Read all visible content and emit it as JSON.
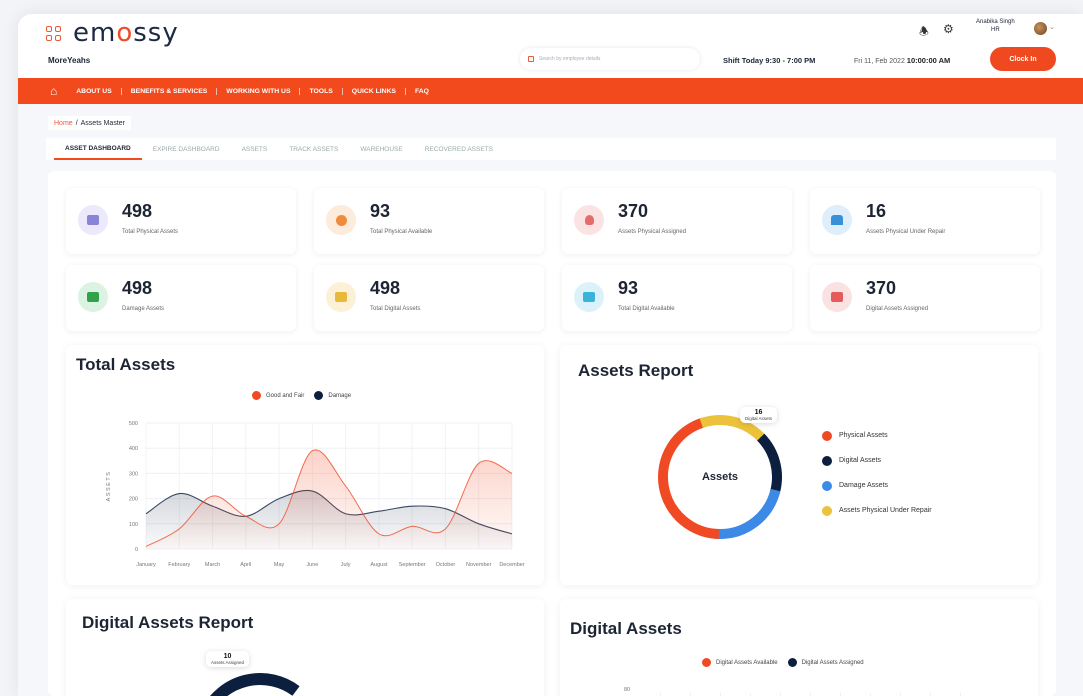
{
  "app": {
    "brand_a": "em",
    "brand_o": "o",
    "brand_b": "ssy",
    "company": "MoreYeahs"
  },
  "header": {
    "search_placeholder": "Search by employee details",
    "shift": "Shift Today 9:30 - 7:00 PM",
    "date_prefix": "Fri 11, Feb 2022",
    "time": "10:00:00 AM",
    "clock_in": "Clock In",
    "user_name": "Anabika Singh",
    "user_sub": "HR"
  },
  "nav": {
    "items": [
      "ABOUT US",
      "BENEFITS & SERVICES",
      "WORKING WITH US",
      "TOOLS",
      "QUICK LINKS",
      "FAQ"
    ]
  },
  "breadcrumb": {
    "home": "Home",
    "sep": "/",
    "current": "Assets Master"
  },
  "tabs": [
    "ASSET DASHBOARD",
    "EXPIRE DASHBOARD",
    "ASSETS",
    "TRACK ASSETS",
    "WAREHOUSE",
    "RECOVERED ASSETS"
  ],
  "cards": [
    {
      "value": "498",
      "label": "Total Physical Assets",
      "color": "#8a84d6",
      "bg": "#ebe9fb"
    },
    {
      "value": "93",
      "label": "Total Physical Available",
      "color": "#f08b3e",
      "bg": "#fdebdc"
    },
    {
      "value": "370",
      "label": "Assets Physical Assigned",
      "color": "#e86b6b",
      "bg": "#fbe3e3"
    },
    {
      "value": "16",
      "label": "Assets Physical Under Repair",
      "color": "#3a8fd9",
      "bg": "#dfeefb"
    },
    {
      "value": "498",
      "label": "Damage Assets",
      "color": "#2fa24a",
      "bg": "#dcf2e2"
    },
    {
      "value": "498",
      "label": "Total Digital Assets",
      "color": "#e9b93a",
      "bg": "#fcf1d6"
    },
    {
      "value": "93",
      "label": "Total Digital Available",
      "color": "#3ab2d9",
      "bg": "#dcf2fa"
    },
    {
      "value": "370",
      "label": "Digital Assets Assigned",
      "color": "#e55a5a",
      "bg": "#fbe2e2"
    }
  ],
  "total_assets": {
    "title": "Total Assets",
    "legend": [
      "Good and Fair",
      "Damage"
    ]
  },
  "assets_report": {
    "title": "Assets Report",
    "center": "Assets",
    "callout_value": "16",
    "callout_label": "Digital Assets",
    "legend": [
      "Physical Assets",
      "Digital Assets",
      "Damage Assets",
      "Assets Physical Under Repair"
    ],
    "colors": [
      "#f04a24",
      "#0d1f3f",
      "#3d8ae6",
      "#ecc13c"
    ]
  },
  "digital_report": {
    "title": "Digital Assets Report",
    "callout_value": "10",
    "callout_label": "Assets Assigned"
  },
  "digital_assets": {
    "title": "Digital Assets",
    "legend": [
      "Digital Assets Available",
      "Digital Assets Assigned"
    ],
    "first_tick": "80"
  },
  "chart_data": [
    {
      "type": "area",
      "title": "Total Assets",
      "ylabel": "ASSETS",
      "categories": [
        "January",
        "February",
        "March",
        "April",
        "May",
        "June",
        "July",
        "August",
        "September",
        "October",
        "November",
        "December"
      ],
      "ylim": [
        0,
        500
      ],
      "yticks": [
        "0",
        "100",
        "200",
        "300",
        "400",
        "500"
      ],
      "series": [
        {
          "name": "Good and Fair",
          "color": "#f04a24",
          "values": [
            10,
            80,
            210,
            130,
            100,
            390,
            250,
            60,
            90,
            80,
            340,
            300
          ]
        },
        {
          "name": "Damage",
          "color": "#0d1f3f",
          "values": [
            140,
            220,
            170,
            130,
            200,
            230,
            140,
            150,
            170,
            160,
            100,
            60
          ]
        }
      ]
    },
    {
      "type": "pie",
      "title": "Assets Report",
      "categories": [
        "Physical Assets",
        "Digital Assets",
        "Damage Assets",
        "Assets Physical Under Repair"
      ],
      "values": [
        45,
        16,
        21,
        18
      ]
    }
  ]
}
